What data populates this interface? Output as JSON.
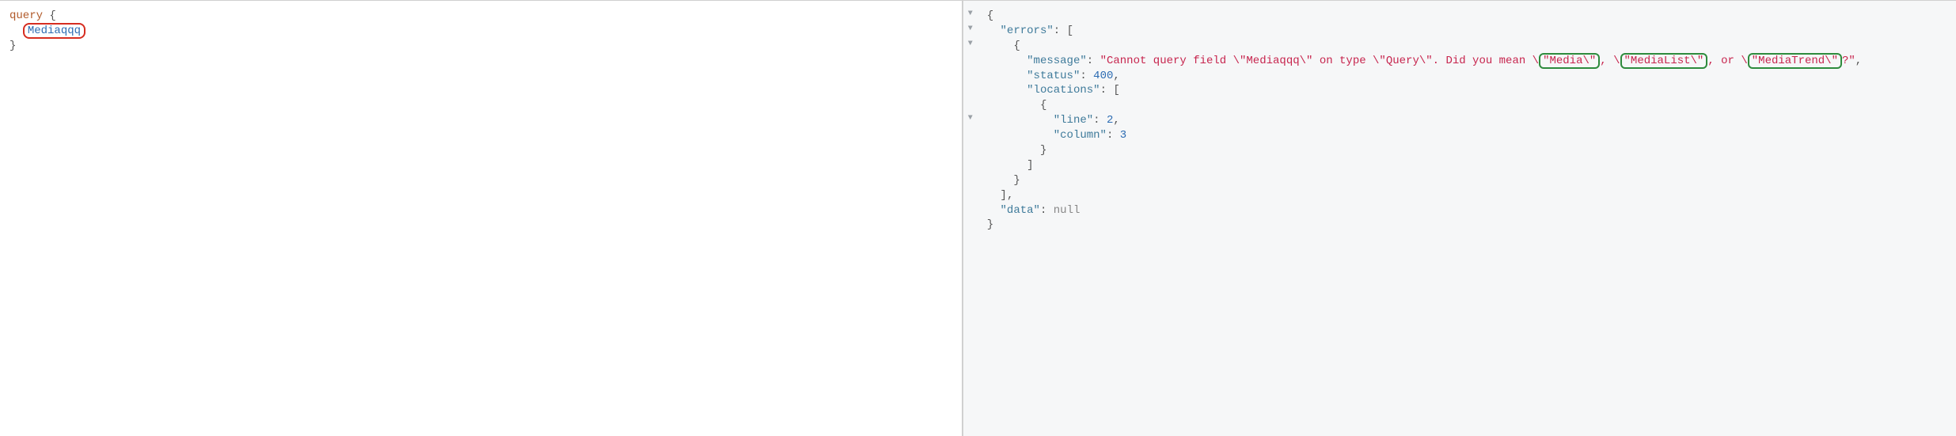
{
  "query_editor": {
    "keyword": "query",
    "open": "{",
    "fieldName": "Mediaqqq",
    "close": "}"
  },
  "response": {
    "open": "{",
    "errorsKey": "\"errors\"",
    "msgKey": "\"message\"",
    "msgPrefix": "\"Cannot query field \\\"Mediaqqq\\\" on type \\\"Query\\\". Did you mean \\",
    "sug1": "\"Media\\\"",
    "between1": ", \\",
    "sug2": "\"MediaList\\\"",
    "between2": ", or \\",
    "sug3": "\"MediaTrend\\\"",
    "msgSuffix": "?\"",
    "statusKey": "\"status\"",
    "statusVal": "400",
    "locKey": "\"locations\"",
    "lineKey": "\"line\"",
    "lineVal": "2",
    "colKey": "\"column\"",
    "colVal": "3",
    "dataKey": "\"data\"",
    "dataVal": "null",
    "close": "}"
  },
  "highlight_colors": {
    "red_box": "#d62d20",
    "green_box": "#2e8b3d"
  },
  "chart_data": {
    "type": "table",
    "title": "GraphQL error response for invalid field query",
    "query_field_attempted": "Mediaqqq",
    "error_message": "Cannot query field \"Mediaqqq\" on type \"Query\". Did you mean \"Media\", \"MediaList\", or \"MediaTrend\"?",
    "status": 400,
    "locations": [
      {
        "line": 2,
        "column": 3
      }
    ],
    "suggestions": [
      "Media",
      "MediaList",
      "MediaTrend"
    ],
    "data": null
  }
}
